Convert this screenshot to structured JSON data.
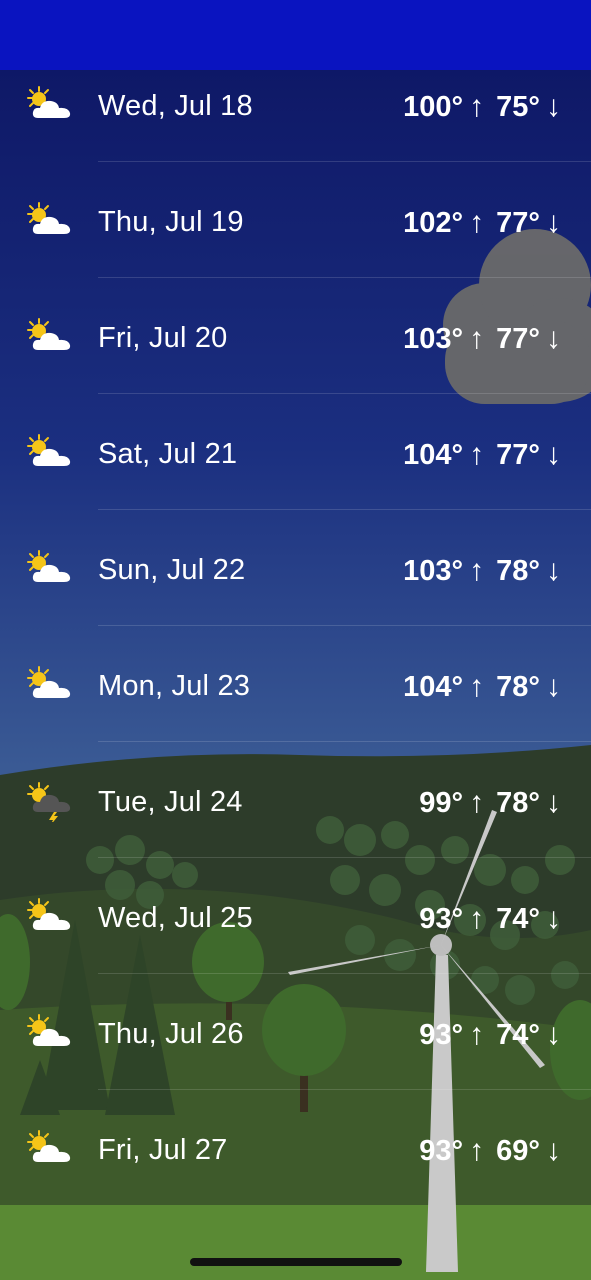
{
  "days": [
    {
      "date": "Wed, Jul 18",
      "high": "100°",
      "low": "75°",
      "icon": "partly-sunny-icon"
    },
    {
      "date": "Thu, Jul 19",
      "high": "102°",
      "low": "77°",
      "icon": "partly-sunny-icon"
    },
    {
      "date": "Fri, Jul 20",
      "high": "103°",
      "low": "77°",
      "icon": "partly-sunny-icon"
    },
    {
      "date": "Sat, Jul 21",
      "high": "104°",
      "low": "77°",
      "icon": "partly-sunny-icon"
    },
    {
      "date": "Sun, Jul 22",
      "high": "103°",
      "low": "78°",
      "icon": "partly-sunny-icon"
    },
    {
      "date": "Mon, Jul 23",
      "high": "104°",
      "low": "78°",
      "icon": "partly-sunny-icon"
    },
    {
      "date": "Tue, Jul 24",
      "high": "99°",
      "low": "78°",
      "icon": "thunderstorm-icon"
    },
    {
      "date": "Wed, Jul 25",
      "high": "93°",
      "low": "74°",
      "icon": "partly-sunny-icon"
    },
    {
      "date": "Thu, Jul 26",
      "high": "93°",
      "low": "74°",
      "icon": "partly-sunny-icon"
    },
    {
      "date": "Fri, Jul 27",
      "high": "93°",
      "low": "69°",
      "icon": "partly-sunny-icon"
    }
  ],
  "arrows": {
    "up": "↑",
    "down": "↓"
  }
}
